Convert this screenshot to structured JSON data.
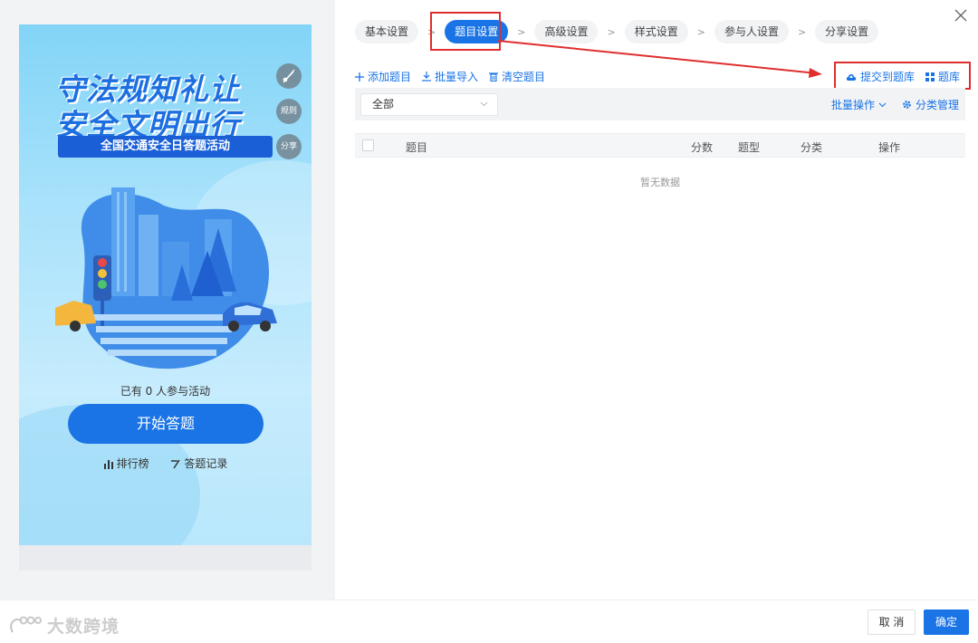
{
  "preview": {
    "title_line1": "守法规知礼让",
    "title_line2": "安全文明出行",
    "subtitle": "全国交通安全日答题活动",
    "side_buttons": {
      "music": "",
      "rules": "规则",
      "share": "分享"
    },
    "participants_text": "已有 0 人参与活动",
    "start_button": "开始答题",
    "ranking_link": "排行榜",
    "records_link": "答题记录"
  },
  "steps": [
    {
      "label": "基本设置",
      "active": false
    },
    {
      "label": "题目设置",
      "active": true
    },
    {
      "label": "高级设置",
      "active": false
    },
    {
      "label": "样式设置",
      "active": false
    },
    {
      "label": "参与人设置",
      "active": false
    },
    {
      "label": "分享设置",
      "active": false
    }
  ],
  "step_separator": ">",
  "toolbar": {
    "add_question": "添加题目",
    "batch_import": "批量导入",
    "clear_questions": "清空题目",
    "submit_to_bank": "提交到题库",
    "question_bank": "题库"
  },
  "filter": {
    "category_select": "全部",
    "batch_ops": "批量操作",
    "category_management": "分类管理"
  },
  "table": {
    "columns": [
      "题目",
      "分数",
      "题型",
      "分类",
      "操作"
    ],
    "rows": [],
    "empty_text": "暂无数据"
  },
  "footer": {
    "watermark": "大数跨境",
    "cancel": "取 消",
    "confirm": "确定"
  },
  "colors": {
    "primary": "#1a74e6",
    "highlight_box": "#e02e2e",
    "panel_bg": "#f2f3f5"
  },
  "icons": {
    "close": "close-icon",
    "add": "plus-icon",
    "import": "download-icon",
    "clear": "trash-icon",
    "submit": "cloud-upload-icon",
    "bank": "grid-icon",
    "settings": "gear-icon",
    "dropdown": "chevron-down-icon"
  }
}
